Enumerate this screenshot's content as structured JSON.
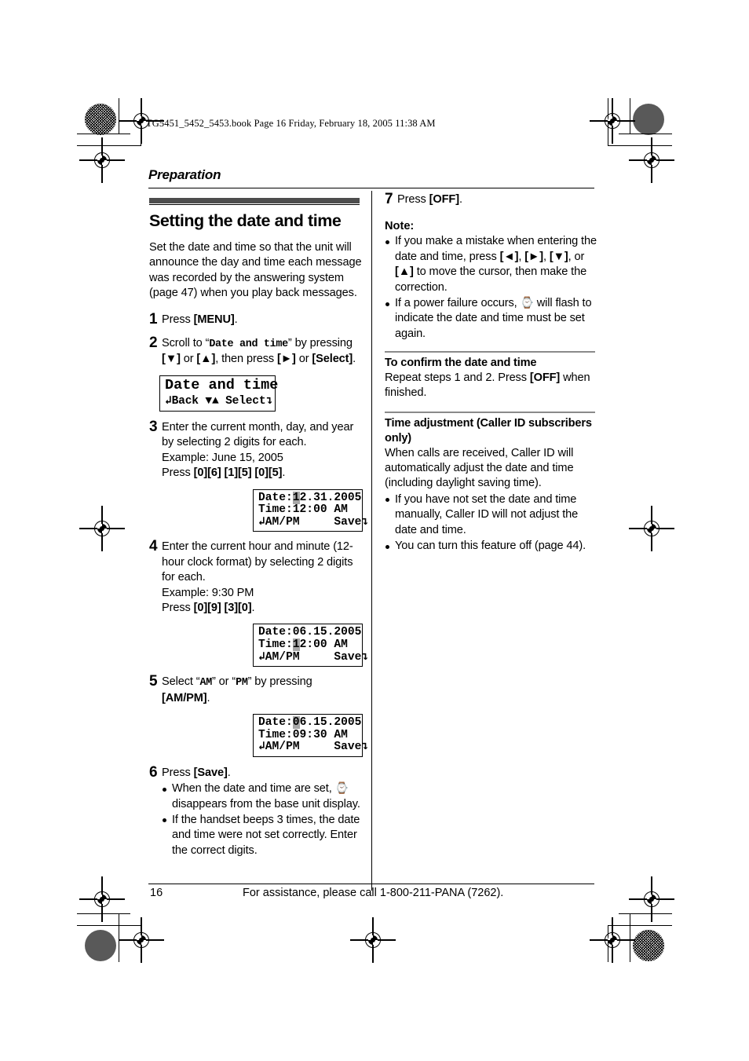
{
  "book_header": "TG5451_5452_5453.book  Page 16  Friday, February 18, 2005  11:38 AM",
  "running_head": "Preparation",
  "footer": {
    "page_number": "16",
    "assistance": "For assistance, please call 1-800-211-PANA (7262)."
  },
  "left_column": {
    "title": "Setting the date and time",
    "intro": "Set the date and time so that the unit will announce the day and time each message was recorded by the answering system (page 47) when you play back messages.",
    "steps": [
      {
        "num": "1",
        "text_1": "Press ",
        "key_1": "[MENU]",
        "text_2": "."
      },
      {
        "num": "2",
        "text_1": "Scroll to “",
        "mono_1": "Date and time",
        "text_2": "” by pressing ",
        "key_1": "[▼]",
        "text_3": " or ",
        "key_2": "[▲]",
        "text_4": ", then press ",
        "key_3": "[►]",
        "text_5": " or ",
        "key_4": "[Select]",
        "text_6": "."
      },
      {
        "num": "3",
        "line_1": "Enter the current month, day, and year by selecting 2 digits for each.",
        "line_2": "Example: June 15, 2005",
        "line_3_pre": "Press ",
        "line_3_keys": "[0][6] [1][5] [0][5]",
        "line_3_post": "."
      },
      {
        "num": "4",
        "line_1": "Enter the current hour and minute (12-hour clock format) by selecting 2 digits for each.",
        "line_2": "Example: 9:30 PM",
        "line_3_pre": "Press ",
        "line_3_keys": "[0][9] [3][0]",
        "line_3_post": "."
      },
      {
        "num": "5",
        "text_1": "Select “",
        "mono_1": "AM",
        "text_2": "” or “",
        "mono_2": "PM",
        "text_3": "” by pressing ",
        "key_1": "[AM/PM]",
        "text_4": "."
      },
      {
        "num": "6",
        "text_1": "Press ",
        "key_1": "[Save]",
        "text_2": ".",
        "bullets": [
          {
            "pre": "When the date and time are set, ",
            "icon": "clock-icon",
            "post": " disappears from the base unit display."
          },
          {
            "pre": "If the handset beeps 3 times, the date and time were not set correctly. Enter the correct digits.",
            "icon": "",
            "post": ""
          }
        ]
      }
    ],
    "lcd_menu": {
      "line_1": "Date and time",
      "soft_left": "Back",
      "soft_mid": "▼▲",
      "soft_right": "Select"
    },
    "lcd_step3": {
      "label_date": "Date:",
      "date_cursor": "1",
      "date_rest": "2.31.2005",
      "label_time": "Time:",
      "time_value": "12:00 AM",
      "soft_left": "AM/PM",
      "soft_right": "Save"
    },
    "lcd_step4": {
      "label_date": "Date:",
      "date_value": "06.15.2005",
      "label_time": "Time:",
      "time_cursor": "1",
      "time_rest": "2:00 AM",
      "soft_left": "AM/PM",
      "soft_right": "Save"
    },
    "lcd_step5": {
      "label_date": "Date:",
      "date_cursor": "0",
      "date_rest": "6.15.2005",
      "label_time": "Time:",
      "time_value": "09:30 AM",
      "soft_left": "AM/PM",
      "soft_right": "Save"
    }
  },
  "right_column": {
    "step7": {
      "num": "7",
      "text_1": "Press ",
      "key_1": "[OFF]",
      "text_2": "."
    },
    "note_heading": "Note:",
    "note_bullets": [
      {
        "t1": "If you make a mistake when entering the date and time, press ",
        "k1": "[◄]",
        "t2": ", ",
        "k2": "[►]",
        "t3": ", ",
        "k3": "[▼]",
        "t4": ", or ",
        "k4": "[▲]",
        "t5": " to move the cursor, then make the correction."
      }
    ],
    "note_power": {
      "pre": "If a power failure occurs, ",
      "icon": "clock-icon",
      "post": " will flash to indicate the date and time must be set again."
    },
    "confirm": {
      "heading": "To confirm the date and time",
      "text_1": "Repeat steps 1 and 2. Press ",
      "key_1": "[OFF]",
      "text_2": " when finished."
    },
    "adjust": {
      "heading": "Time adjustment (Caller ID subscribers only)",
      "body": "When calls are received, Caller ID will automatically adjust the date and time (including daylight saving time).",
      "bullets": [
        "If you have not set the date and time manually, Caller ID will not adjust the date and time.",
        "You can turn this feature off (page 44)."
      ]
    }
  }
}
